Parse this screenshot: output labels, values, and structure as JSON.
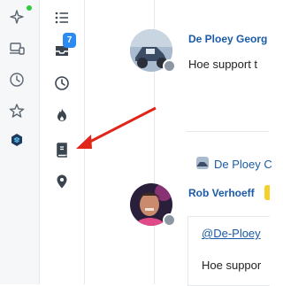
{
  "rail2": {
    "inbox_badge": "7"
  },
  "feed": {
    "post1": {
      "author": "De Ploey Georg",
      "text": "Hoe support t"
    },
    "share": {
      "author": "De Ploey C"
    },
    "post2": {
      "author": "Rob Verhoeff",
      "mention": "@De-Ploey",
      "text": "Hoe suppor"
    }
  },
  "annotation": {
    "arrow_color": "#e0251b"
  }
}
